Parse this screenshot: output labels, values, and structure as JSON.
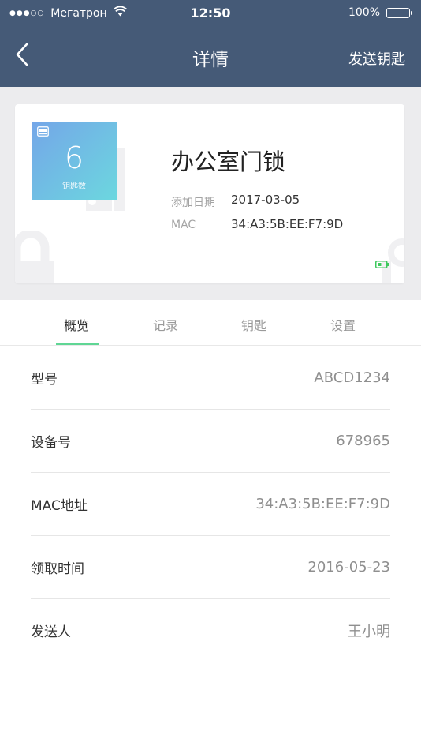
{
  "status_bar": {
    "signal": "●●●○○",
    "carrier": "Мегатрон",
    "time": "12:50",
    "battery_percent": "100%"
  },
  "nav": {
    "title": "详情",
    "action_label": "发送钥匙"
  },
  "lock_card": {
    "key_count": "6",
    "key_count_label": "钥匙数",
    "name": "办公室门锁",
    "added_date_label": "添加日期",
    "added_date_value": "2017-03-05",
    "mac_label": "MAC",
    "mac_value": "34:A3:5B:EE:F7:9D",
    "battery_color": "#3cc85c"
  },
  "tabs": [
    {
      "label": "概览",
      "active": true
    },
    {
      "label": "记录",
      "active": false
    },
    {
      "label": "钥匙",
      "active": false
    },
    {
      "label": "设置",
      "active": false
    }
  ],
  "details": [
    {
      "label": "型号",
      "value": "ABCD1234"
    },
    {
      "label": "设备号",
      "value": "678965"
    },
    {
      "label": "MAC地址",
      "value": "34:A3:5B:EE:F7:9D"
    },
    {
      "label": "领取时间",
      "value": "2016-05-23"
    },
    {
      "label": "发送人",
      "value": "王小明"
    }
  ],
  "colors": {
    "header_bg": "#455a77",
    "accent_green": "#5fd694",
    "tile_gradient_start": "#74a6e8",
    "tile_gradient_end": "#6cd7df"
  }
}
